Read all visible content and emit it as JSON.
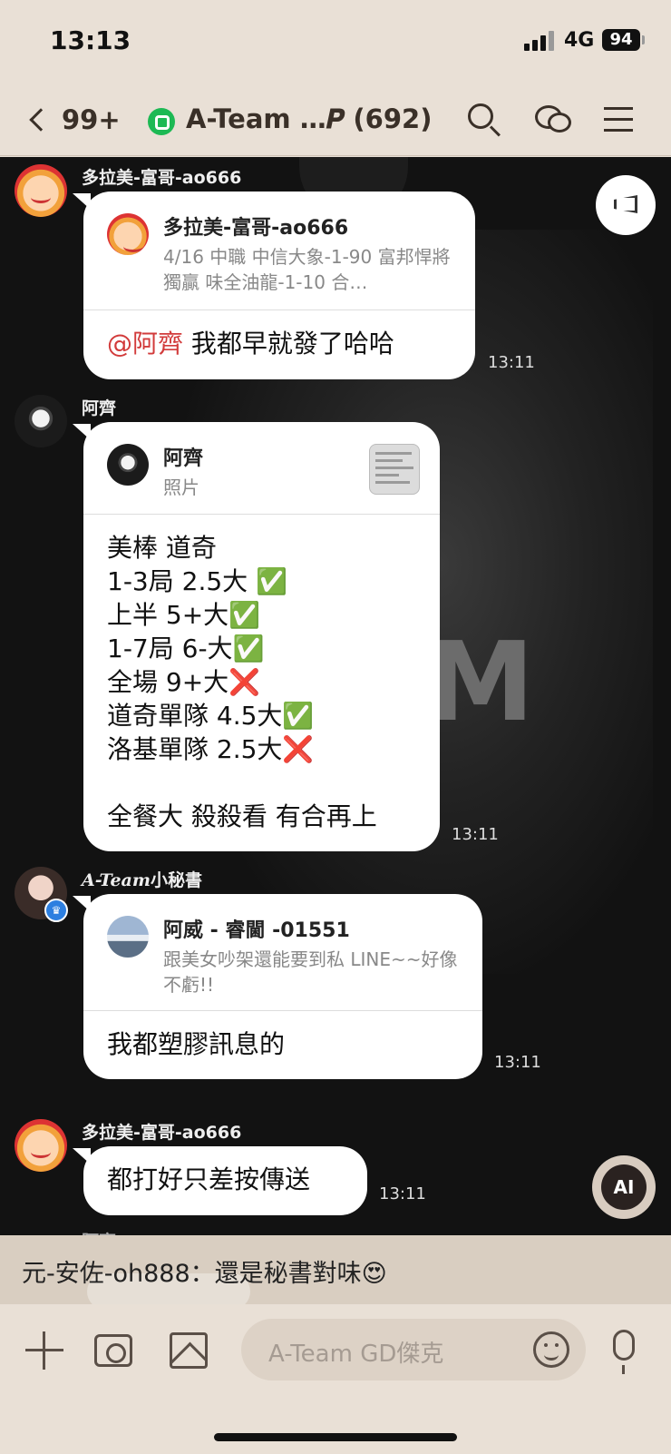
{
  "status_bar": {
    "time": "13:13",
    "network": "4G",
    "battery": "94"
  },
  "header": {
    "back_count": "99+",
    "group_title": "A-Team …𝑷 (692)"
  },
  "messages": [
    {
      "sender": "多拉美-富哥-ao666",
      "quote_name": "多拉美-富哥-ao666",
      "quote_text": "4/16 中職 中信大象-1-90 富邦悍將獨贏 味全油龍-1-10 合…",
      "mention": "@阿齊",
      "text": " 我都早就發了哈哈",
      "time": "13:11"
    },
    {
      "sender": "阿齊",
      "quote_name": "阿齊",
      "quote_text": "照片",
      "text": "美棒 道奇\n1-3局 2.5大 ✅\n上半 5+大✅\n1-7局 6-大✅\n全場 9+大❌\n道奇單隊 4.5大✅\n洛基單隊 2.5大❌\n\n全餐大 殺殺看 有合再上",
      "time": "13:11"
    },
    {
      "sender_styled": "A-Team",
      "sender_suffix": "小秘書",
      "quote_name": "阿威 - 睿閫 -01551",
      "quote_text": "跟美女吵架還能要到私 LINE~~好像不虧!!",
      "text": "我都塑膠訊息的",
      "time": "13:11"
    },
    {
      "sender": "多拉美-富哥-ao666",
      "text": "都打好只差按傳送",
      "time": "13:11"
    }
  ],
  "peek_sender": "阿齊",
  "ai_button_label": "AI",
  "notification": {
    "text": "元-安佐-oh888：還是秘書對味😍"
  },
  "input": {
    "placeholder": "A-Team GD傑克"
  },
  "icons": [
    "back-chevron-icon",
    "group-icon",
    "search-icon",
    "chat-icon",
    "menu-icon",
    "announcement-icon",
    "plus-icon",
    "camera-icon",
    "image-icon",
    "emoji-icon",
    "mic-icon"
  ],
  "colors": {
    "header_bg": "#e9e0d6",
    "chat_bg": "#121212",
    "mention": "#d23b3b",
    "group_badge": "#1db954"
  }
}
